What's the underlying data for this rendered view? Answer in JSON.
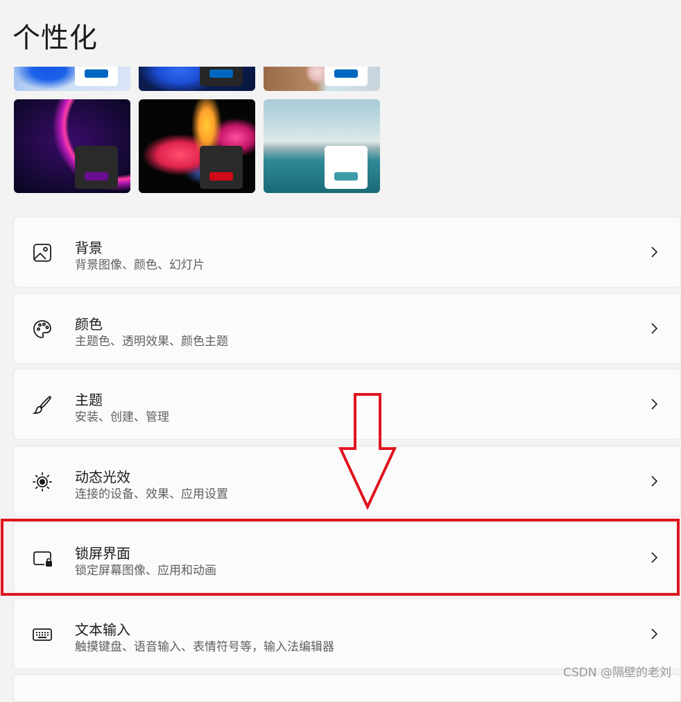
{
  "page": {
    "title": "个性化"
  },
  "themes": [
    {
      "name": "theme-thumbnail-1",
      "swatch_color": "#0067c0",
      "box_color": "#ffffff"
    },
    {
      "name": "theme-thumbnail-2",
      "swatch_color": "#0067c0",
      "box_color": "#262626"
    },
    {
      "name": "theme-thumbnail-3",
      "swatch_color": "#0067c0",
      "box_color": "#ffffff"
    },
    {
      "name": "theme-thumbnail-4",
      "swatch_color": "#6a0d91",
      "box_color": "#2a2a2a"
    },
    {
      "name": "theme-thumbnail-5",
      "swatch_color": "#d10a17",
      "box_color": "#2a2a2a"
    },
    {
      "name": "theme-thumbnail-6",
      "swatch_color": "#3d9ba8",
      "box_color": "#ffffff"
    }
  ],
  "settings": [
    {
      "id": "background",
      "title": "背景",
      "subtitle": "背景图像、颜色、幻灯片",
      "icon": "image-icon"
    },
    {
      "id": "colors",
      "title": "颜色",
      "subtitle": "主题色、透明效果、颜色主题",
      "icon": "palette-icon"
    },
    {
      "id": "themes",
      "title": "主题",
      "subtitle": "安装、创建、管理",
      "icon": "brush-icon"
    },
    {
      "id": "dynamic-lighting",
      "title": "动态光效",
      "subtitle": "连接的设备、效果、应用设置",
      "icon": "dynamic-lighting-icon"
    },
    {
      "id": "lock-screen",
      "title": "锁屏界面",
      "subtitle": "锁定屏幕图像、应用和动画",
      "icon": "lock-screen-icon"
    },
    {
      "id": "text-input",
      "title": "文本输入",
      "subtitle": "触摸键盘、语音输入、表情符号等，输入法编辑器",
      "icon": "keyboard-icon"
    }
  ],
  "annotation": {
    "highlight_color": "#e0141f",
    "highlighted_item": "lock-screen"
  },
  "watermark": "CSDN @隔壁的老刘"
}
